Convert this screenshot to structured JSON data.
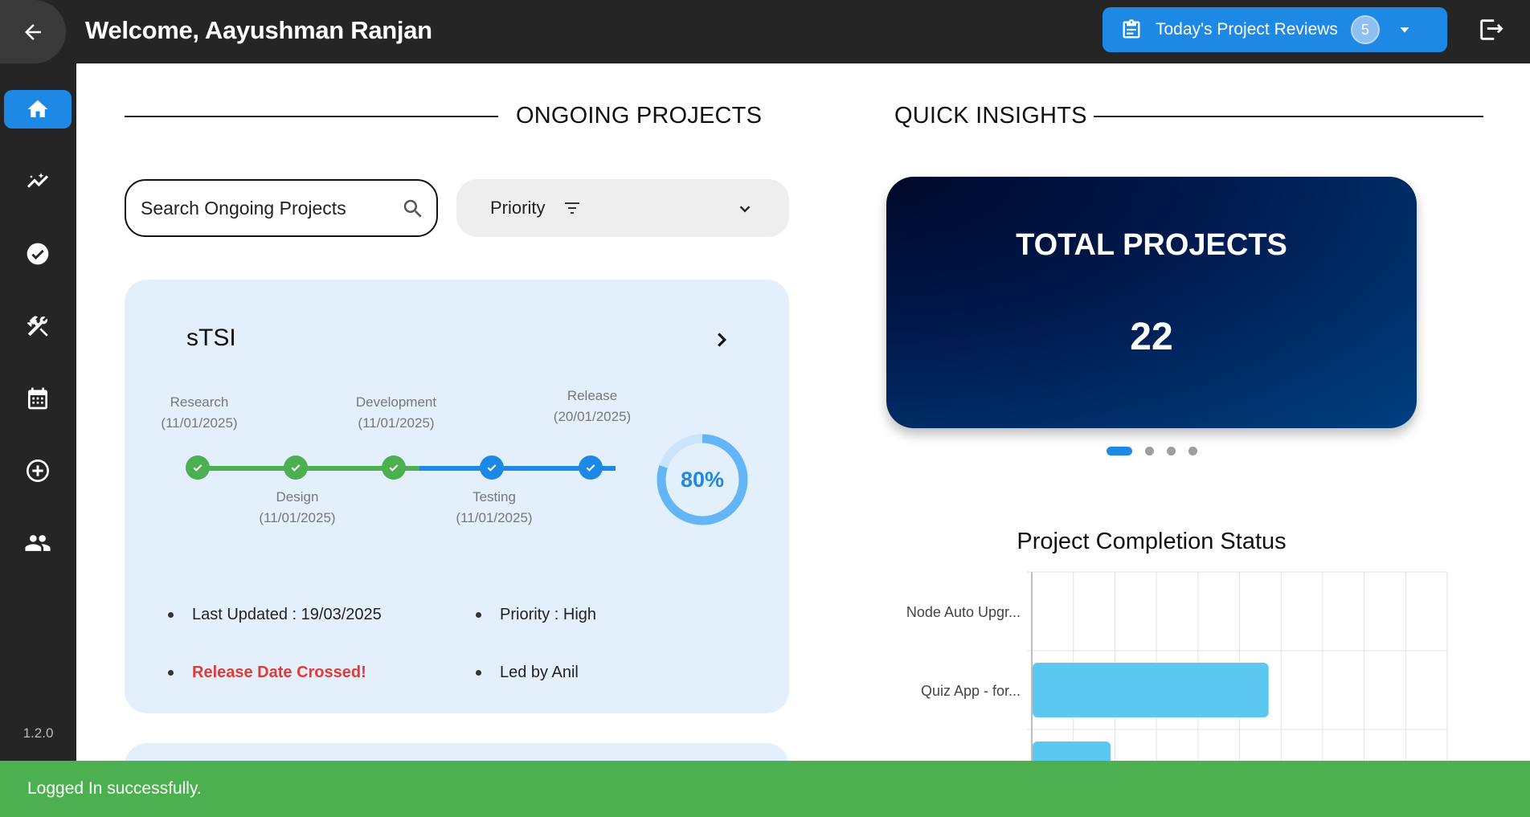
{
  "header": {
    "welcome": "Welcome, Aayushman Ranjan",
    "reviews_label": "Today's Project Reviews",
    "reviews_count": "5"
  },
  "sidebar": {
    "items": [
      {
        "icon": "home-icon",
        "active": true
      },
      {
        "icon": "insights-icon",
        "active": false
      },
      {
        "icon": "check-circle-icon",
        "active": false
      },
      {
        "icon": "tools-icon",
        "active": false
      },
      {
        "icon": "calendar-icon",
        "active": false
      },
      {
        "icon": "add-circle-icon",
        "active": false
      },
      {
        "icon": "people-icon",
        "active": false
      }
    ],
    "version": "1.2.0"
  },
  "ongoing": {
    "title": "ONGOING PROJECTS",
    "search_placeholder": "Search Ongoing Projects",
    "priority_label": "Priority"
  },
  "project": {
    "name": "sTSI",
    "stages": [
      {
        "name": "Research",
        "date": "(11/01/2025)",
        "done": true
      },
      {
        "name": "Design",
        "date": "(11/01/2025)",
        "done": true
      },
      {
        "name": "Development",
        "date": "(11/01/2025)",
        "done": true
      },
      {
        "name": "Testing",
        "date": "(11/01/2025)",
        "done": false
      },
      {
        "name": "Release",
        "date": "(20/01/2025)",
        "done": false
      }
    ],
    "progress": 80,
    "progress_label": "80%",
    "last_updated": "Last Updated : 19/03/2025",
    "priority": "Priority : High",
    "warning": "Release Date Crossed!",
    "lead": "Led by Anil"
  },
  "insights": {
    "title": "QUICK INSIGHTS",
    "card_title": "TOTAL PROJECTS",
    "card_value": "22",
    "pages": 4,
    "active_page": 0
  },
  "colors": {
    "accent": "#1e88e5",
    "done": "#4caf50",
    "warning": "#e53935",
    "bar": "#5bc8f2",
    "toast": "#4caf50"
  },
  "chart_data": {
    "type": "bar",
    "orientation": "horizontal",
    "title": "Project Completion Status",
    "categories": [
      "Node Auto Upgr...",
      "Quiz App - for...",
      ""
    ],
    "values": [
      0,
      57,
      19
    ],
    "xlim": [
      0,
      100
    ],
    "grid": true
  },
  "toast": {
    "message": "Logged In successfully."
  }
}
